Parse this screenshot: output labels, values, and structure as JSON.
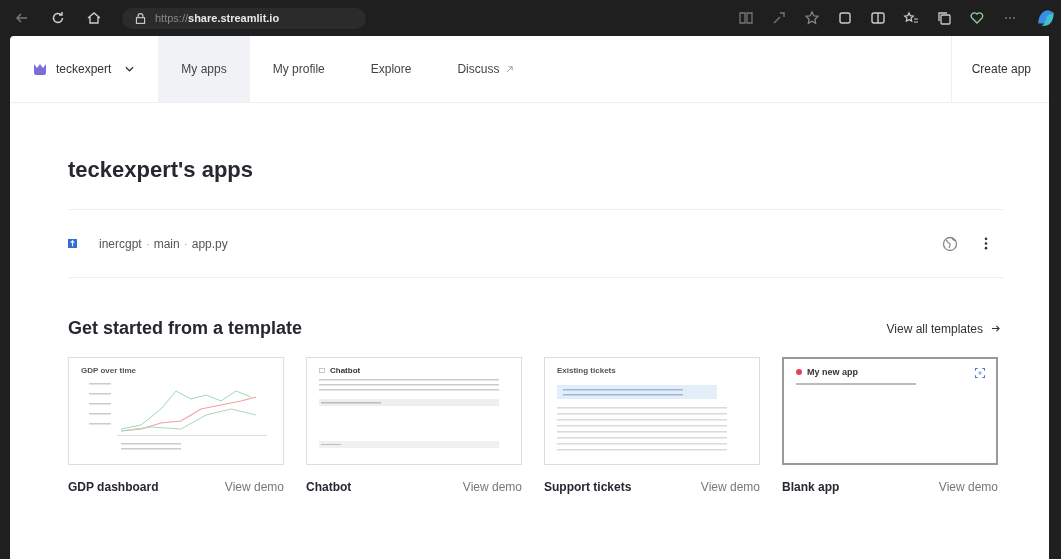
{
  "browser": {
    "url_prefix": "https://",
    "url_host": "share.streamlit.io"
  },
  "nav": {
    "workspace": "teckexpert",
    "tabs": [
      {
        "label": "My apps",
        "selected": true,
        "external": false
      },
      {
        "label": "My profile",
        "selected": false,
        "external": false
      },
      {
        "label": "Explore",
        "selected": false,
        "external": false
      },
      {
        "label": "Discuss",
        "selected": false,
        "external": true
      }
    ],
    "create_button": "Create app"
  },
  "title": "teckexpert's apps",
  "apps": [
    {
      "repo": "inercgpt",
      "separator_1": "·",
      "branch": "main",
      "separator_2": "·",
      "file": "app.py",
      "public": true
    }
  ],
  "templates_section": {
    "heading": "Get started from a template",
    "view_all": "View all templates",
    "templates": [
      {
        "kind": "chart",
        "name": "GDP dashboard",
        "preview_title": "GDP over time",
        "demo": "View demo",
        "selected": false
      },
      {
        "kind": "chat",
        "name": "Chatbot",
        "preview_title": "Chatbot",
        "demo": "View demo",
        "selected": false
      },
      {
        "kind": "table",
        "name": "Support tickets",
        "preview_title": "Existing tickets",
        "demo": "View demo",
        "selected": false
      },
      {
        "kind": "blank",
        "name": "Blank app",
        "preview_title": "My new app",
        "demo": "View demo",
        "selected": true
      }
    ]
  }
}
